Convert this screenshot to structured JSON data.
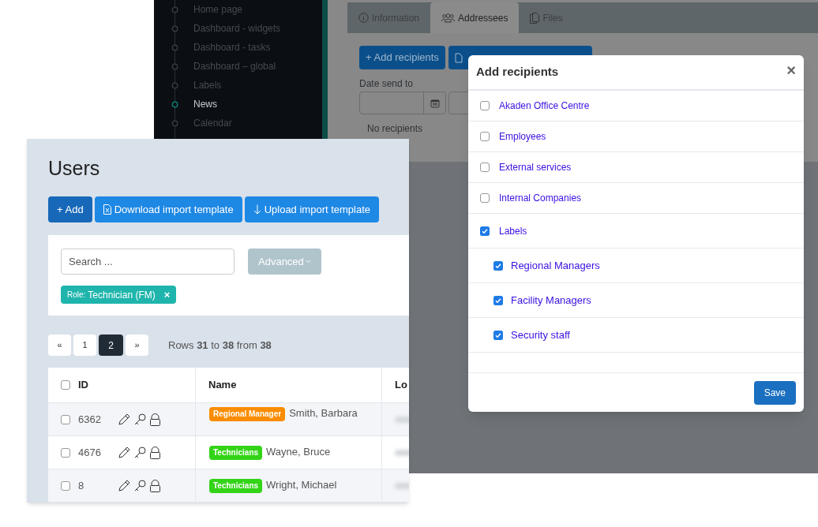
{
  "sidebar": {
    "items": [
      {
        "label": "Home page",
        "selected": false
      },
      {
        "label": "Dashboard - widgets",
        "selected": false
      },
      {
        "label": "Dashboard - tasks",
        "selected": false
      },
      {
        "label": "Dashboard – global",
        "selected": false
      },
      {
        "label": "Labels",
        "selected": false
      },
      {
        "label": "News",
        "selected": true
      },
      {
        "label": "Calendar",
        "selected": false
      }
    ]
  },
  "tabs": [
    {
      "label": "Information",
      "kind": "info",
      "selected": false
    },
    {
      "label": "Addressees",
      "kind": "people",
      "selected": true
    },
    {
      "label": "Files",
      "kind": "files",
      "selected": false
    }
  ],
  "addressees": {
    "add_button": "+ Add recipients",
    "date_label": "Date send to",
    "empty_text": "No recipients"
  },
  "modal": {
    "title": "Add recipients",
    "close": "×",
    "items": [
      {
        "label": "Akaden Office Centre",
        "checked": false
      },
      {
        "label": "Employees",
        "checked": false
      },
      {
        "label": "External services",
        "checked": false
      },
      {
        "label": "Internal Companies",
        "checked": false
      },
      {
        "label": "Labels",
        "checked": true,
        "children": [
          {
            "label": "Regional Managers",
            "checked": true
          },
          {
            "label": "Facility Managers",
            "checked": true
          },
          {
            "label": "Security staff",
            "checked": true
          }
        ]
      }
    ],
    "save": "Save"
  },
  "users": {
    "title": "Users",
    "buttons": [
      {
        "label": "+ Add",
        "kind": "primary"
      },
      {
        "label": "Download import template",
        "kind": "download"
      },
      {
        "label": "Upload import template",
        "kind": "upload"
      }
    ],
    "search": {
      "placeholder": "Search ..."
    },
    "advanced": "Advanced",
    "filter_tag": {
      "key": "Role:",
      "value": "Technician (FM)",
      "remove": "×"
    },
    "pagination": [
      {
        "label": "«",
        "selected": false
      },
      {
        "label": "1",
        "selected": false
      },
      {
        "label": "2",
        "selected": true
      },
      {
        "label": "»",
        "selected": false
      }
    ],
    "rows_info": "Rows **31** to **38** from **38**",
    "table": {
      "select_all_checked": false,
      "columns": [
        "ID",
        "Name",
        "Lo"
      ],
      "rows": [
        {
          "checked": false,
          "id": "6362",
          "tag": {
            "label": "Regional Manager",
            "color": "#fb8c00"
          },
          "name": "Smith, Barbara"
        },
        {
          "checked": false,
          "id": "4676",
          "tag": {
            "label": "Technicians",
            "color": "#33d417"
          },
          "name": "Wayne, Bruce"
        },
        {
          "checked": false,
          "id": "8",
          "tag": {
            "label": "Technicians",
            "color": "#33d417"
          },
          "name": "Wright, Michael"
        }
      ]
    }
  }
}
